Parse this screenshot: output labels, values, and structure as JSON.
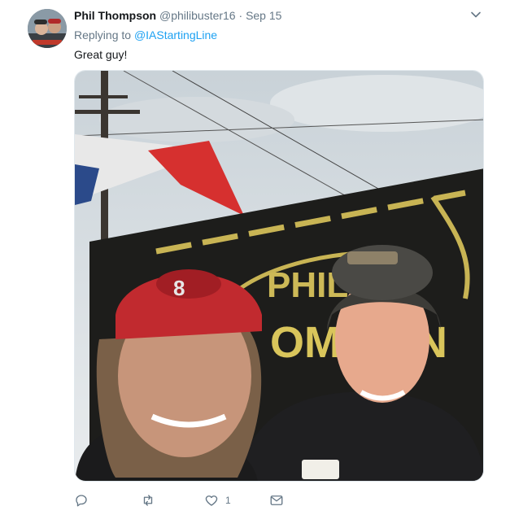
{
  "tweet": {
    "author_name": "Phil Thompson",
    "handle": "@philibuster16",
    "separator": "·",
    "date": "Sep 15",
    "replying_prefix": "Replying to",
    "replying_to": "@IAStartingLine",
    "text": "Great guy!",
    "media_sign_text": "PHIL",
    "media_sign_text_2": "OMP ON",
    "actions": {
      "reply_count": "",
      "retweet_count": "",
      "like_count": "1"
    }
  },
  "colors": {
    "link": "#1da1f2",
    "secondary_text": "#657786",
    "primary_text": "#14171a"
  },
  "icons": [
    "avatar",
    "chevron-down-icon",
    "reply-icon",
    "retweet-icon",
    "heart-icon",
    "message-icon"
  ]
}
